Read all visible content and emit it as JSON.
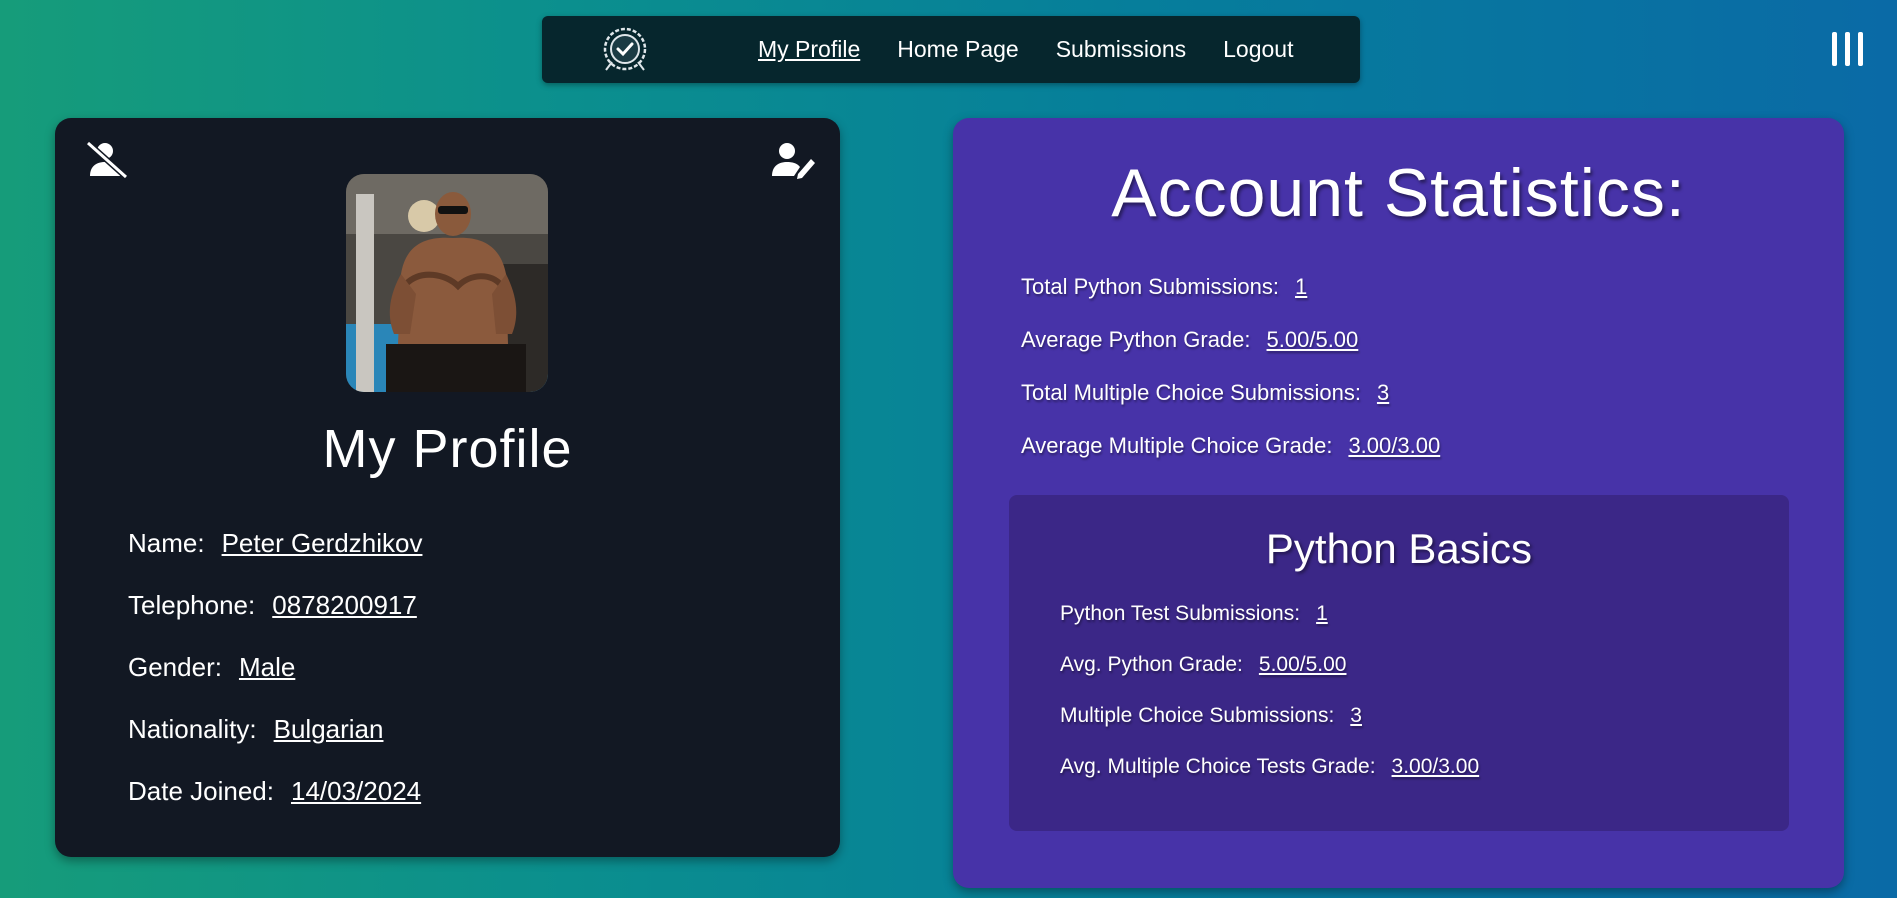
{
  "nav": {
    "logo_icon": "quiz-badge-logo-icon",
    "links": [
      {
        "label": "My Profile",
        "active": true
      },
      {
        "label": "Home Page",
        "active": false
      },
      {
        "label": "Submissions",
        "active": false
      },
      {
        "label": "Logout",
        "active": false
      }
    ],
    "menu_icon": "vertical-bars-menu-icon"
  },
  "profile": {
    "deactivate_icon": "user-slash-icon",
    "edit_icon": "user-pen-icon",
    "avatar": "profile-photo",
    "title": "My Profile",
    "fields": [
      {
        "label": "Name:",
        "value": "Peter Gerdzhikov"
      },
      {
        "label": "Telephone:",
        "value": "0878200917"
      },
      {
        "label": "Gender:",
        "value": "Male"
      },
      {
        "label": "Nationality:",
        "value": "Bulgarian"
      },
      {
        "label": "Date Joined:",
        "value": "14/03/2024"
      }
    ]
  },
  "stats": {
    "title": "Account Statistics:",
    "items": [
      {
        "label": "Total Python Submissions:",
        "value": "1"
      },
      {
        "label": "Average Python Grade:",
        "value": "5.00/5.00"
      },
      {
        "label": "Total Multiple Choice Submissions:",
        "value": "3"
      },
      {
        "label": "Average Multiple Choice Grade:",
        "value": "3.00/3.00"
      }
    ],
    "basics": {
      "title": "Python Basics",
      "items": [
        {
          "label": "Python Test Submissions:",
          "value": "1"
        },
        {
          "label": "Avg. Python Grade:",
          "value": "5.00/5.00"
        },
        {
          "label": "Multiple Choice Submissions:",
          "value": "3"
        },
        {
          "label": "Avg. Multiple Choice Tests Grade:",
          "value": "3.00/3.00"
        }
      ]
    }
  },
  "colors": {
    "background_start": "#169c7a",
    "background_end": "#0a6aa6",
    "navbar": "#06262d",
    "profile_card": "#121823",
    "stats_card": "#4733a8",
    "basics_panel": "#3b2787",
    "text": "#ffffff"
  }
}
